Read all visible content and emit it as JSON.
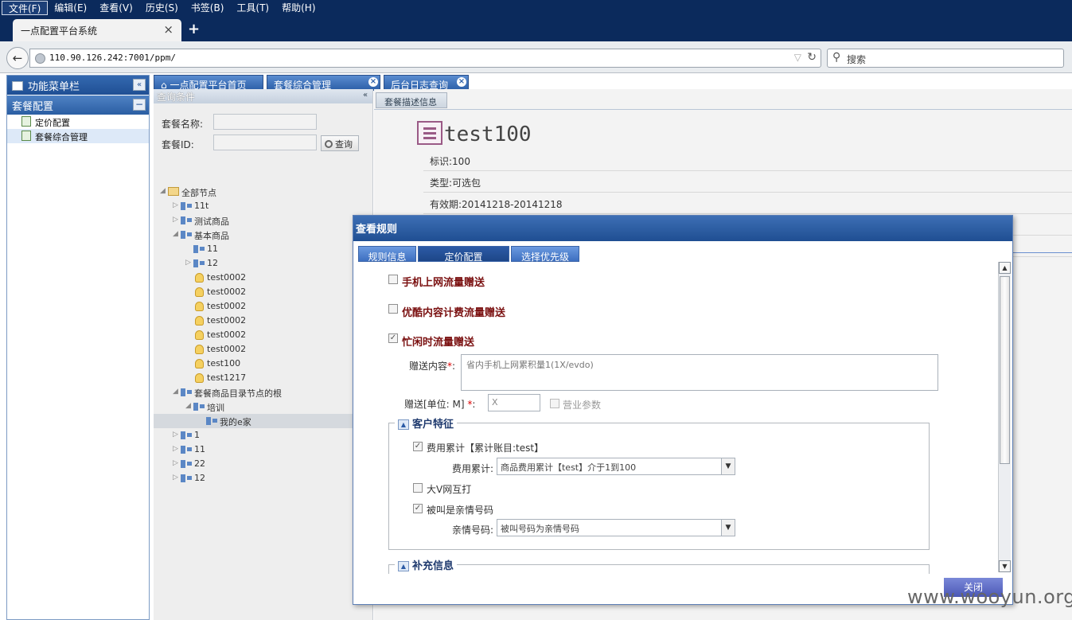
{
  "browser": {
    "menu": [
      "文件(F)",
      "编辑(E)",
      "查看(V)",
      "历史(S)",
      "书签(B)",
      "工具(T)",
      "帮助(H)"
    ],
    "tab_title": "一点配置平台系统",
    "tab_close": "×",
    "new_tab": "+",
    "url": "110.90.126.242:7001/ppm/",
    "search_placeholder": "搜索"
  },
  "sidebar": {
    "header": "功能菜单栏",
    "section": "套餐配置",
    "items": [
      {
        "label": "定价配置",
        "selected": false
      },
      {
        "label": "套餐综合管理",
        "selected": true
      }
    ]
  },
  "app_tabs": [
    {
      "label": "一点配置平台首页",
      "icon": "home-icon",
      "closable": false
    },
    {
      "label": "套餐综合管理",
      "closable": true
    },
    {
      "label": "后台日志查询",
      "closable": true
    }
  ],
  "query": {
    "title": "查询条件",
    "name_label": "套餐名称:",
    "id_label": "套餐ID:",
    "search_button": "查询"
  },
  "tree": [
    {
      "label": "全部节点",
      "level": 0,
      "expanded": true,
      "icon": "folder-icon"
    },
    {
      "label": "11t",
      "level": 1,
      "expanded": false,
      "icon": "network-icon"
    },
    {
      "label": "测试商品",
      "level": 1,
      "expanded": false,
      "icon": "network-icon"
    },
    {
      "label": "基本商品",
      "level": 1,
      "expanded": true,
      "icon": "network-icon"
    },
    {
      "label": "11",
      "level": 2,
      "icon": "network-icon"
    },
    {
      "label": "12",
      "level": 2,
      "expanded": false,
      "icon": "network-icon"
    },
    {
      "label": "test0002",
      "level": 2,
      "icon": "bulb-icon"
    },
    {
      "label": "test0002",
      "level": 2,
      "icon": "bulb-icon"
    },
    {
      "label": "test0002",
      "level": 2,
      "icon": "bulb-icon"
    },
    {
      "label": "test0002",
      "level": 2,
      "icon": "bulb-icon"
    },
    {
      "label": "test0002",
      "level": 2,
      "icon": "bulb-icon"
    },
    {
      "label": "test0002",
      "level": 2,
      "icon": "bulb-icon"
    },
    {
      "label": "test100",
      "level": 2,
      "icon": "bulb-icon"
    },
    {
      "label": "test1217",
      "level": 2,
      "icon": "bulb-icon"
    },
    {
      "label": "套餐商品目录节点的根",
      "level": 1,
      "expanded": true,
      "icon": "network-icon"
    },
    {
      "label": "培训",
      "level": 2,
      "expanded": true,
      "icon": "network-icon"
    },
    {
      "label": "我的e家",
      "level": 3,
      "icon": "network-icon",
      "selected": true
    },
    {
      "label": "1",
      "level": 1,
      "expanded": false,
      "icon": "network-icon"
    },
    {
      "label": "11",
      "level": 1,
      "expanded": false,
      "icon": "network-icon"
    },
    {
      "label": "22",
      "level": 1,
      "expanded": false,
      "icon": "network-icon"
    },
    {
      "label": "12",
      "level": 1,
      "expanded": false,
      "icon": "network-icon"
    }
  ],
  "detail": {
    "tab": "套餐描述信息",
    "title": "test100",
    "rows": [
      "标识:100",
      "类型:可选包",
      "有效期:20141218-20141218",
      "",
      ""
    ]
  },
  "modal": {
    "title": "查看规则",
    "tabs": [
      "规则信息",
      "定价配置",
      "选择优先级"
    ],
    "active_tab": 1,
    "rules": [
      {
        "title": "手机上网流量赠送",
        "checked": false
      },
      {
        "title": "优酷内容计费流量赠送",
        "checked": false
      },
      {
        "title": "忙闲时流量赠送",
        "checked": true
      }
    ],
    "gift_content_label": "赠送内容",
    "gift_content_value": "省内手机上网累积量1(1X/evdo)",
    "gift_unit_label": "赠送[单位: M]",
    "required_mark": "*",
    "gift_unit_value": "X",
    "business_param_label": "营业参数",
    "customer_section": "客户特征",
    "cost_cb_label": "费用累计【累计账目:test】",
    "cost_label": "费用累计:",
    "cost_value": "商品费用累计【test】介于1到100",
    "bigv_label": "大V网互打",
    "family_cb_label": "被叫是亲情号码",
    "family_label": "亲情号码:",
    "family_value": "被叫号码为亲情号码",
    "supplement_section": "补充信息",
    "close_button": "关闭"
  },
  "watermark": "www.wooyun.org"
}
